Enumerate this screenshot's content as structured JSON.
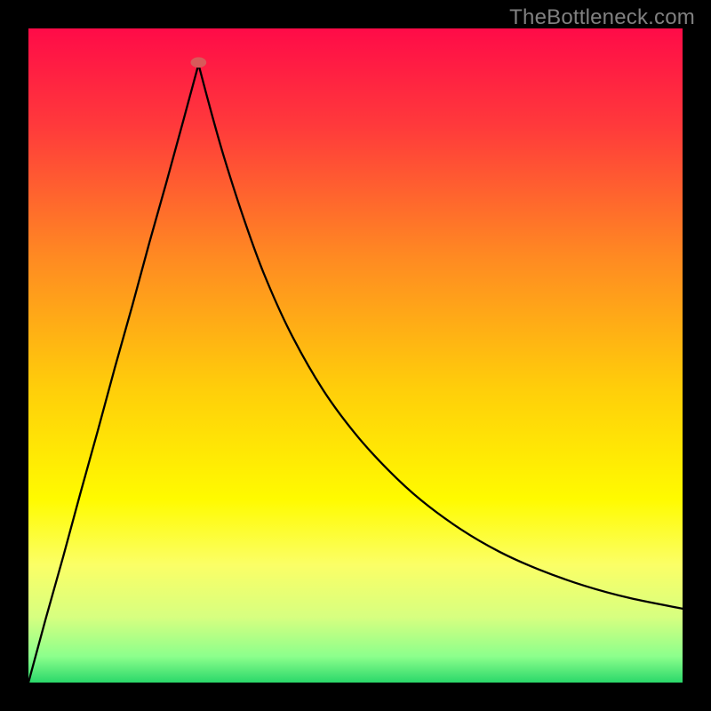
{
  "watermark": "TheBottleneck.com",
  "chart_data": {
    "type": "line",
    "title": "",
    "xlabel": "",
    "ylabel": "",
    "xlim": [
      0,
      100
    ],
    "ylim": [
      0,
      100
    ],
    "grid": false,
    "legend": false,
    "background_gradient": {
      "type": "vertical",
      "stops": [
        {
          "offset": 0.0,
          "color": "#ff0b48"
        },
        {
          "offset": 0.15,
          "color": "#ff3a3b"
        },
        {
          "offset": 0.35,
          "color": "#ff8a22"
        },
        {
          "offset": 0.55,
          "color": "#ffce0a"
        },
        {
          "offset": 0.72,
          "color": "#fffb00"
        },
        {
          "offset": 0.82,
          "color": "#fbff66"
        },
        {
          "offset": 0.9,
          "color": "#d7ff80"
        },
        {
          "offset": 0.96,
          "color": "#8cff8c"
        },
        {
          "offset": 1.0,
          "color": "#2bd86a"
        }
      ]
    },
    "green_band": {
      "y_top": 94.5,
      "y_bottom": 100
    },
    "series": [
      {
        "name": "left-branch",
        "x": [
          0.0,
          2.6,
          5.3,
          7.9,
          10.6,
          13.2,
          15.9,
          18.5,
          21.1,
          23.7,
          26.0
        ],
        "y": [
          0.0,
          9.6,
          19.2,
          28.8,
          38.5,
          48.1,
          57.7,
          67.3,
          76.5,
          86.0,
          94.5
        ]
      },
      {
        "name": "right-branch",
        "x": [
          26.0,
          28.0,
          30.0,
          33.0,
          36.0,
          40.0,
          45.0,
          50.0,
          55.0,
          60.0,
          66.0,
          72.0,
          78.0,
          85.0,
          92.0,
          100.0
        ],
        "y": [
          94.5,
          87.0,
          80.0,
          70.7,
          62.5,
          53.6,
          44.8,
          38.0,
          32.5,
          27.9,
          23.5,
          20.0,
          17.3,
          14.8,
          12.9,
          11.3
        ]
      }
    ],
    "marker": {
      "x": 26.0,
      "y": 94.8,
      "rx": 1.2,
      "ry": 0.8,
      "color": "#d85a5a"
    }
  }
}
